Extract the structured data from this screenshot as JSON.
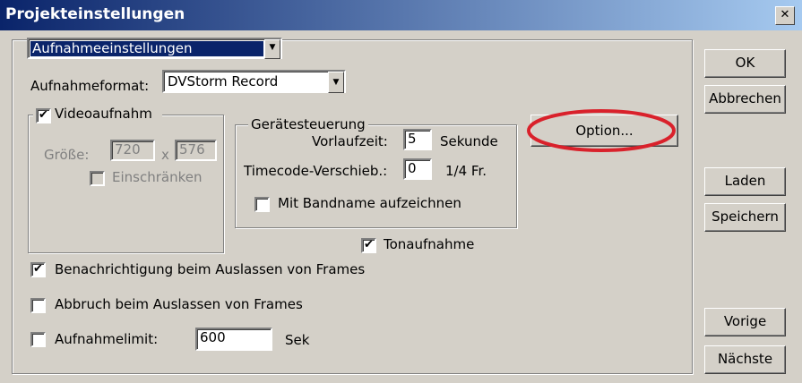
{
  "window": {
    "title": "Projekteinstellungen",
    "close_symbol": "✕"
  },
  "section_select": {
    "value": "Aufnahmeeinstellungen"
  },
  "aufnahmeformat": {
    "label": "Aufnahmeformat:",
    "value": "DVStorm Record"
  },
  "videoaufnahm": {
    "label": "Videoaufnahm",
    "checked": true,
    "groesse_label": "Größe:",
    "width_value": "720",
    "x_label": "x",
    "height_value": "576",
    "einschraenken_label": "Einschränken"
  },
  "geraetesteuerung": {
    "title": "Gerätesteuerung",
    "vorlaufzeit_label": "Vorlaufzeit:",
    "vorlaufzeit_value": "5",
    "vorlaufzeit_unit": "Sekunde",
    "timecode_label": "Timecode-Verschieb.:",
    "timecode_value": "0",
    "timecode_unit": "1/4 Fr.",
    "bandname_label": "Mit Bandname aufzeichnen"
  },
  "option_button": "Option...",
  "tonaufnahme": {
    "label": "Tonaufnahme",
    "checked": true
  },
  "benachrichtigung": {
    "label": "Benachrichtigung beim Auslassen von Frames",
    "checked": true
  },
  "abbruch": {
    "label": "Abbruch beim Auslassen von Frames",
    "checked": false
  },
  "aufnahmelimit": {
    "label": "Aufnahmelimit:",
    "value": "600",
    "unit": "Sek",
    "checked": false
  },
  "side_buttons": {
    "ok": "OK",
    "abbrechen": "Abbrechen",
    "laden": "Laden",
    "speichern": "Speichern",
    "vorige": "Vorige",
    "naechste": "Nächste"
  },
  "colors": {
    "titlebar": "#0a246a",
    "dialog_bg": "#d4d0c8",
    "annotation_circle": "#d9212b"
  }
}
